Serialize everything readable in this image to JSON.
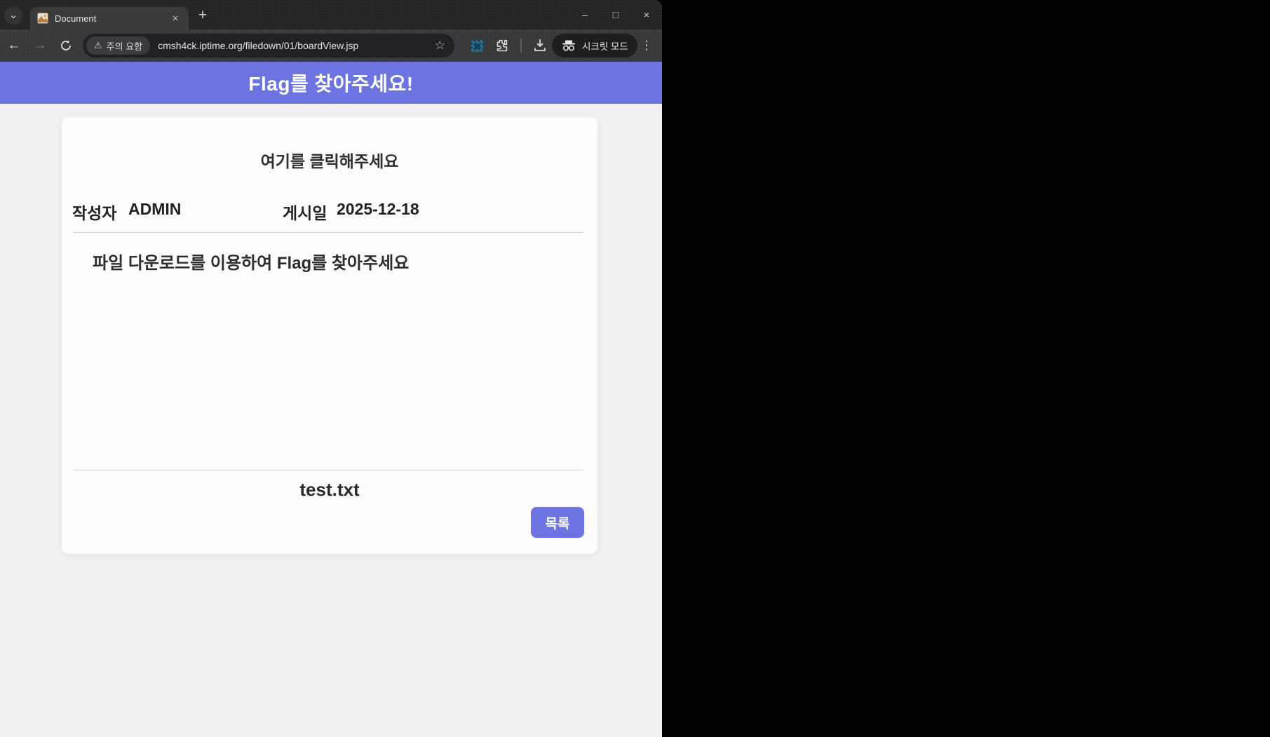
{
  "window": {
    "tab": {
      "title": "Document"
    },
    "tab_strip": {
      "chevron": "⌄",
      "new_tab": "+",
      "tab_close": "×"
    },
    "controls": {
      "minimize": "–",
      "maximize": "□",
      "close": "×"
    }
  },
  "toolbar": {
    "back": "←",
    "forward": "→",
    "warning_icon": "⚠",
    "security_warning": "주의 요함",
    "url": "cmsh4ck.iptime.org/filedown/01/boardView.jsp",
    "star": "☆",
    "incognito_label": "시크릿 모드",
    "menu": "⋮"
  },
  "banner": {
    "title": "Flag를 찾아주세요!"
  },
  "post": {
    "title": "여기를 클릭해주세요",
    "author_label": "작성자",
    "author": "ADMIN",
    "date_label": "게시일",
    "date": "2025-12-18",
    "body": "파일 다운로드를 이용하여 Flag를 찾아주세요",
    "attachment": "test.txt",
    "list_button": "목록"
  },
  "colors": {
    "accent": "#6B74E0",
    "page_bg": "#F1F1F2",
    "banner_text": "#FFFFFF"
  }
}
